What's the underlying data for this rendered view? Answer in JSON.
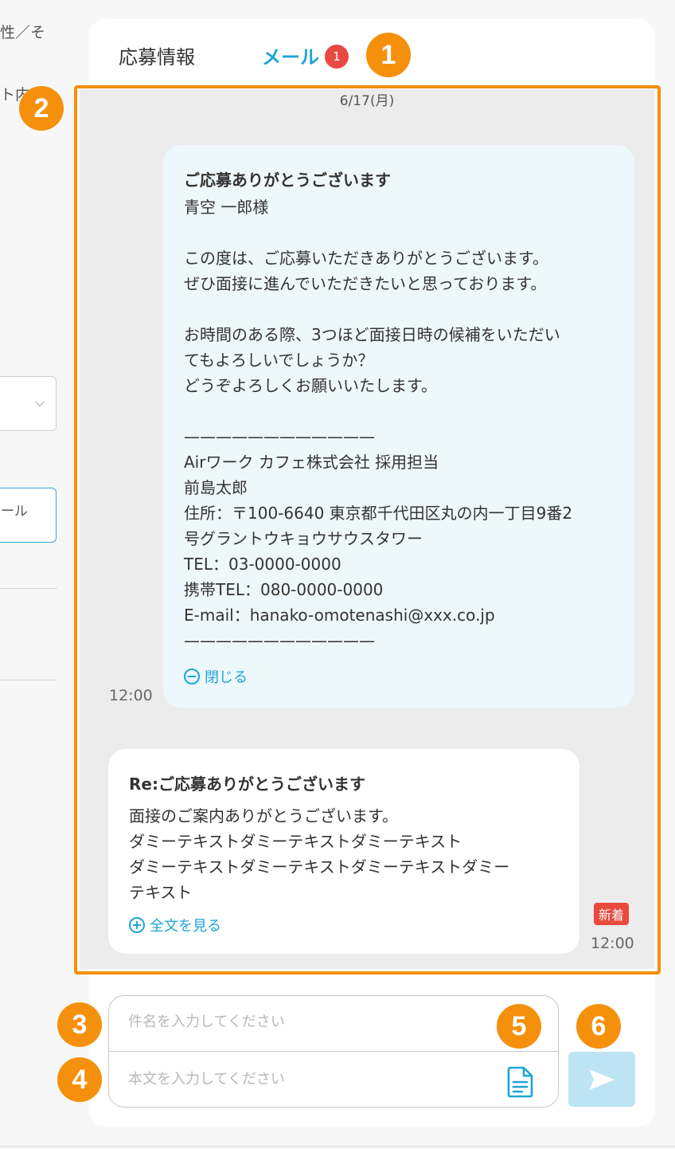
{
  "left_pane": {
    "text_top": "性／そ",
    "text_second": "ト内",
    "button_label": "ール"
  },
  "tabs": {
    "apply_info": "応募情報",
    "mail": "メール",
    "mail_badge": "1"
  },
  "thread": {
    "date": "6/17(月)",
    "outgoing": {
      "subject": "ご応募ありがとうございます",
      "lines": [
        "青空 一郎様",
        "",
        "この度は、ご応募いただきありがとうございます。",
        "ぜひ面接に進んでいただきたいと思っております。",
        "",
        "お時間のある際、3つほど面接日時の候補をいただい",
        "てもよろしいでしょうか？",
        "どうぞよろしくお願いいたします。",
        "",
        "————————————",
        "Airワーク カフェ株式会社 採用担当",
        "前島太郎",
        "住所：〒100-6640 東京都千代田区丸の内一丁目9番2",
        "号グラントウキョウサウスタワー",
        "TEL：03-0000-0000",
        "携帯TEL：080-0000-0000",
        "E-mail：hanako-omotenashi@xxx.co.jp",
        "————————————"
      ],
      "toggle_label": "閉じる",
      "time": "12:00"
    },
    "incoming": {
      "subject": "Re:ご応募ありがとうございます",
      "lines": [
        "面接のご案内ありがとうございます。",
        "ダミーテキストダミーテキストダミーテキスト",
        "ダミーテキストダミーテキストダミーテキストダミー",
        "テキスト"
      ],
      "toggle_label": "全文を見る",
      "new_badge": "新着",
      "time": "12:00"
    }
  },
  "compose": {
    "subject_placeholder": "件名を入力してください",
    "body_placeholder": "本文を入力してください"
  },
  "annotations": [
    "1",
    "2",
    "3",
    "4",
    "5",
    "6"
  ],
  "colors": {
    "accent": "#1ea5d6",
    "annotation": "#f5900c",
    "badge_red": "#e84a3f",
    "outgoing_bubble": "#edf8fd",
    "thread_bg": "#ececec"
  }
}
